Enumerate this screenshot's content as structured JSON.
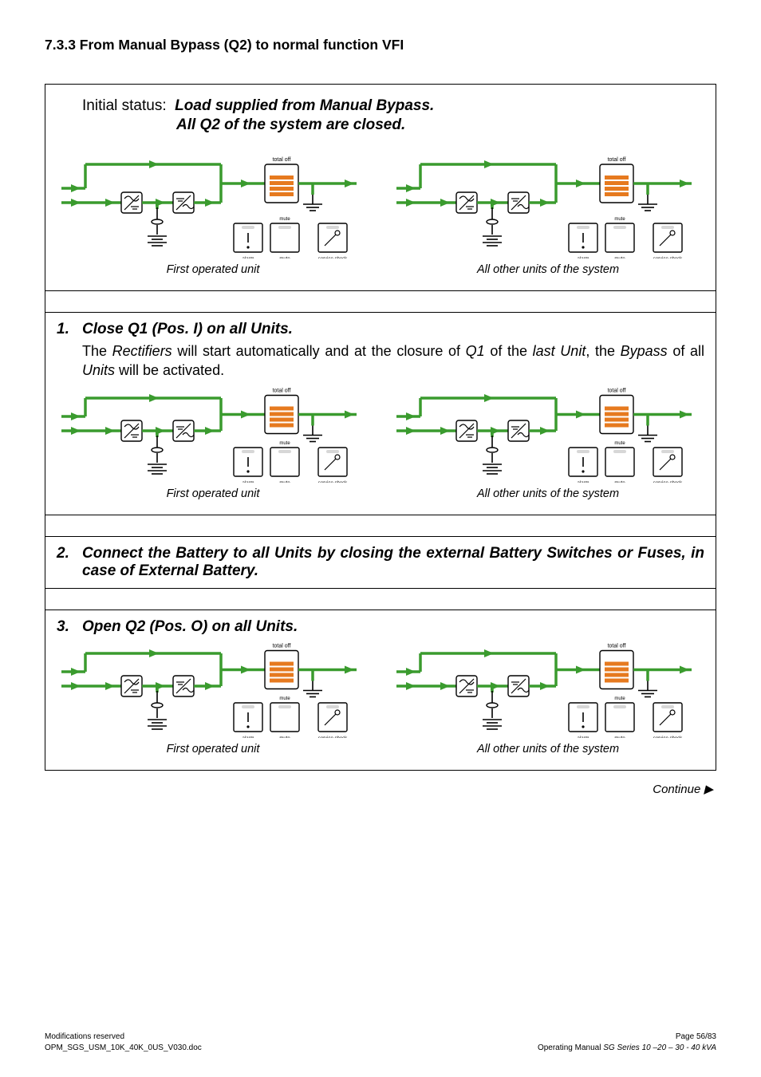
{
  "section_heading": "7.3.3   From Manual Bypass (Q2) to normal function VFI",
  "initial_status": {
    "prefix": "Initial status:",
    "line1": "Load supplied from Manual Bypass.",
    "line2": "All Q2 of the system are closed."
  },
  "captions": {
    "first_unit": "First operated unit",
    "other_units": "All other units of the system"
  },
  "steps": [
    {
      "n": "1.",
      "title": "Close Q1 (Pos. I) on all Units.",
      "desc_html": "The <i>Rectifiers</i> will start automatically and at the closure of <i>Q1</i> of the <i>last Unit</i>, the <i>Bypass</i> of all <i>Units</i> will be activated.",
      "has_diagram": true
    },
    {
      "n": "2.",
      "title": "Connect the Battery to all Units by closing the external Battery Switches or Fuses, in case of External Battery.",
      "has_diagram": false
    },
    {
      "n": "3.",
      "title": "Open Q2 (Pos. O) on all Units.",
      "has_diagram": true
    }
  ],
  "diagram_labels": {
    "total_off": "total off",
    "mute": "mute",
    "alarm": "alarm",
    "service_check": "service check"
  },
  "continue_text": "Continue ▶",
  "footer": {
    "left1": "Modifications reserved",
    "left2": "OPM_SGS_USM_10K_40K_0US_V030.doc",
    "right1": "Page 56/83",
    "right2_pre": "Operating Manual ",
    "right2_ital": "SG Series 10 –20 – 30 - 40 kVA"
  }
}
